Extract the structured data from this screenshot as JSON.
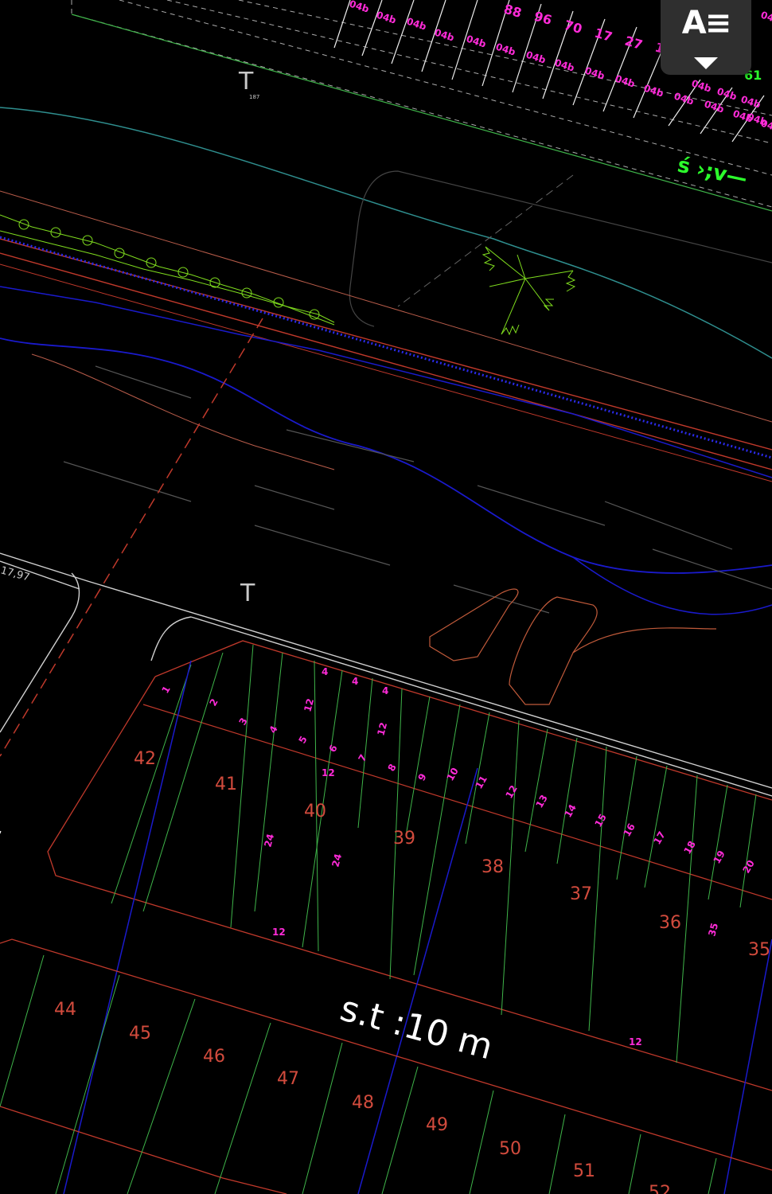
{
  "toolbar": {
    "text_style_button_label": "A≡",
    "text_style_icon": "text-style-icon",
    "dropdown_icon": "triangle-down-icon"
  },
  "drawing": {
    "road_label": "s.t :10 m",
    "partial_m_label": "m",
    "coord_label": "17,97",
    "green_label": "ś ›;v—",
    "t_marker": "T",
    "t_marker_sub": "187",
    "top_lot_numbers": [
      "88",
      "96",
      "70",
      "17",
      "27",
      "1"
    ],
    "top_corner_label": "61",
    "top_small_labels": [
      "04b",
      "04b",
      "04b",
      "04b",
      "04b",
      "04b",
      "04b",
      "04b",
      "04b",
      "04b",
      "04b",
      "04b",
      "04b",
      "04b",
      "04b",
      "04b",
      "04b",
      "04b",
      "04b",
      "04b"
    ],
    "row1_lot_numbers": [
      "1",
      "2",
      "3",
      "4",
      "5",
      "6",
      "7",
      "8",
      "9",
      "10",
      "11",
      "12",
      "13",
      "14",
      "15",
      "16",
      "17",
      "18",
      "19",
      "20"
    ],
    "row1_widths": [
      "4",
      "4",
      "4"
    ],
    "row1_depth_labels": [
      "12",
      "12",
      "12",
      "12",
      "12"
    ],
    "row1_big_lots": [
      "42",
      "41",
      "40",
      "39",
      "38",
      "37",
      "36",
      "35"
    ],
    "block_dimension_labels": [
      "24",
      "24",
      "35"
    ],
    "row2_lot_numbers": [
      "44",
      "45",
      "46",
      "47",
      "48",
      "49",
      "50",
      "51",
      "52"
    ],
    "colors": {
      "background": "#000000",
      "lot_line_red": "#c0392b",
      "lot_line_green": "#3fb54a",
      "contour_blue": "#1a1acc",
      "road_white": "#d0d0d0",
      "dim_magenta": "#ff2bd8",
      "tree_green": "#7fdc1e"
    }
  }
}
